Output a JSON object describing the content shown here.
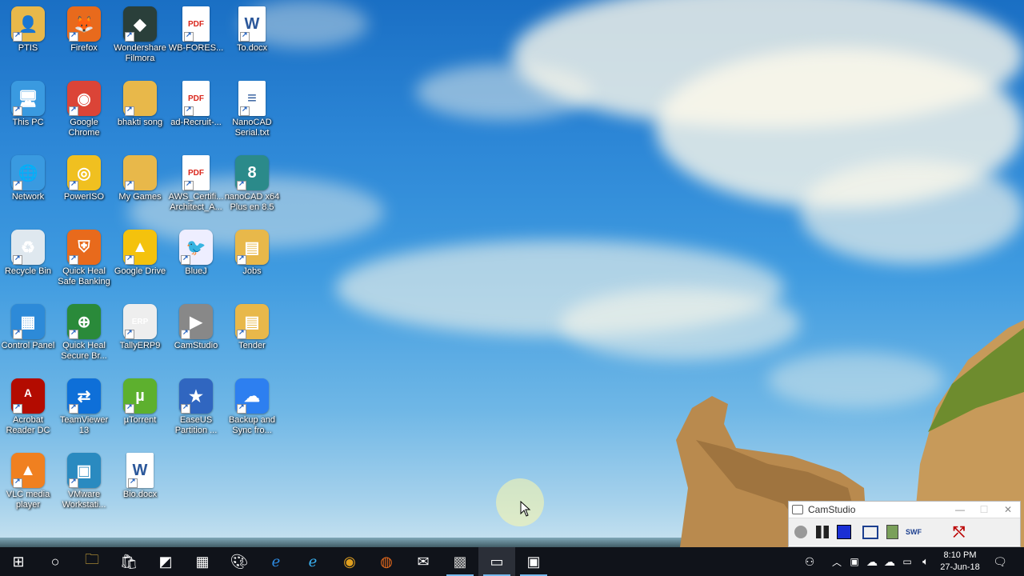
{
  "desktop_icons": [
    {
      "label": "PTIS",
      "icon": "folder-person-icon"
    },
    {
      "label": "Firefox",
      "icon": "firefox-icon"
    },
    {
      "label": "Wondershare Filmora",
      "icon": "filmora-icon"
    },
    {
      "label": "WB-FORES...",
      "icon": "pdf-icon"
    },
    {
      "label": "To.docx",
      "icon": "word-doc-icon"
    },
    {
      "label": "This PC",
      "icon": "computer-icon"
    },
    {
      "label": "Google Chrome",
      "icon": "chrome-icon"
    },
    {
      "label": "bhakti song",
      "icon": "folder-icon"
    },
    {
      "label": "ad-Recruit-...",
      "icon": "pdf-icon"
    },
    {
      "label": "NanoCAD Serial.txt",
      "icon": "text-file-icon"
    },
    {
      "label": "Network",
      "icon": "network-icon"
    },
    {
      "label": "PowerISO",
      "icon": "poweriso-icon"
    },
    {
      "label": "My Games",
      "icon": "folder-icon"
    },
    {
      "label": "AWS_Certifi... Architect_A...",
      "icon": "pdf-icon"
    },
    {
      "label": "nanoCAD x64 Plus en 8.5",
      "icon": "nanocad-icon"
    },
    {
      "label": "Recycle Bin",
      "icon": "recycle-bin-icon"
    },
    {
      "label": "Quick Heal Safe Banking",
      "icon": "quickheal-banking-icon"
    },
    {
      "label": "Google Drive",
      "icon": "google-drive-icon"
    },
    {
      "label": "BlueJ",
      "icon": "bluej-icon"
    },
    {
      "label": "Jobs",
      "icon": "folder-pdf-icon"
    },
    {
      "label": "Control Panel",
      "icon": "control-panel-icon"
    },
    {
      "label": "Quick Heal Secure Br...",
      "icon": "quickheal-browser-icon"
    },
    {
      "label": "TallyERP9",
      "icon": "tally-icon"
    },
    {
      "label": "CamStudio",
      "icon": "camstudio-icon"
    },
    {
      "label": "Tender",
      "icon": "folder-pdf-icon"
    },
    {
      "label": "Acrobat Reader DC",
      "icon": "acrobat-icon"
    },
    {
      "label": "TeamViewer 13",
      "icon": "teamviewer-icon"
    },
    {
      "label": "µTorrent",
      "icon": "utorrent-icon"
    },
    {
      "label": "EaseUS Partition ...",
      "icon": "easeus-icon"
    },
    {
      "label": "Backup and Sync fro...",
      "icon": "backup-sync-icon"
    },
    {
      "label": "VLC media player",
      "icon": "vlc-icon"
    },
    {
      "label": "VMware Workstati...",
      "icon": "vmware-icon"
    },
    {
      "label": "Bio.docx",
      "icon": "word-doc-icon"
    }
  ],
  "taskbar": {
    "items": [
      "windows-start-icon",
      "cortana-search-icon",
      "file-explorer-icon",
      "store-icon",
      "sticky-notes-icon",
      "calculator-icon",
      "paint-icon",
      "edge-icon",
      "internet-explorer-icon",
      "chrome-icon",
      "firefox-icon",
      "mail-icon",
      "tally-icon",
      "camstudio-icon",
      "vmware-icon"
    ],
    "tray_icons": [
      "people-icon",
      "chevron-up-icon",
      "usb-icon",
      "onedrive-icon",
      "cloud-icon",
      "network-icon",
      "volume-icon"
    ],
    "time": "8:10 PM",
    "date": "27-Jun-18",
    "notification_icon": "action-center-icon"
  },
  "camstudio": {
    "title": "CamStudio",
    "tools": [
      "record-icon",
      "pause-icon",
      "stop-icon",
      "region-icon",
      "annotate-icon",
      "swf-icon",
      "exit-icon"
    ]
  },
  "colors": {
    "taskbar": "#10131a",
    "accent": "#76b9ed",
    "sky": "#2c86d6"
  }
}
